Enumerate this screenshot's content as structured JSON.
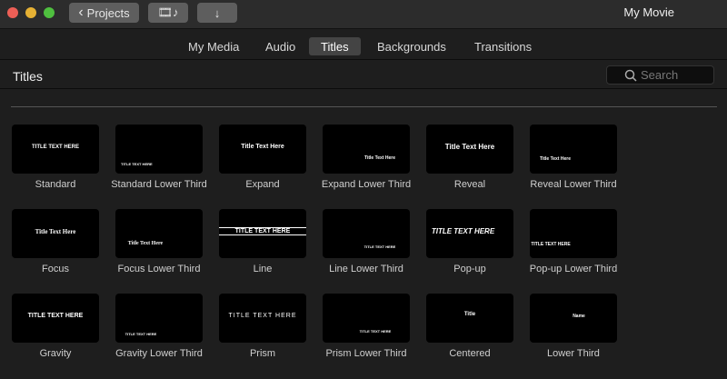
{
  "window": {
    "title": "My Movie",
    "back_label": "Projects"
  },
  "colors": {
    "close": "#ed5f56",
    "minimize": "#e6b134",
    "zoom": "#4fbf3f"
  },
  "tabs": [
    {
      "label": "My Media"
    },
    {
      "label": "Audio"
    },
    {
      "label": "Titles",
      "active": true
    },
    {
      "label": "Backgrounds"
    },
    {
      "label": "Transitions"
    }
  ],
  "header": {
    "title": "Titles",
    "search_placeholder": "Search"
  },
  "titles": [
    {
      "name": "Standard",
      "preview": "TITLE TEXT HERE"
    },
    {
      "name": "Standard Lower Third",
      "preview": "TITLE TEXT HERE"
    },
    {
      "name": "Expand",
      "preview": "Title Text Here"
    },
    {
      "name": "Expand Lower Third",
      "preview": "Title Text Here"
    },
    {
      "name": "Reveal",
      "preview": "Title Text Here"
    },
    {
      "name": "Reveal Lower Third",
      "preview": "Title Text Here"
    },
    {
      "name": "Focus",
      "preview": "Title Text Here"
    },
    {
      "name": "Focus Lower Third",
      "preview": "Title Text Here"
    },
    {
      "name": "Line",
      "preview": "TITLE TEXT HERE"
    },
    {
      "name": "Line Lower Third",
      "preview": "TITLE TEXT HERE"
    },
    {
      "name": "Pop-up",
      "preview": "TITLE TEXT HERE"
    },
    {
      "name": "Pop-up Lower Third",
      "preview": "TITLE TEXT HERE"
    },
    {
      "name": "Gravity",
      "preview": "TITLE TEXT HERE"
    },
    {
      "name": "Gravity Lower Third",
      "preview": "TITLE TEXT HERE"
    },
    {
      "name": "Prism",
      "preview": "TITLE TEXT HERE"
    },
    {
      "name": "Prism Lower Third",
      "preview": "TITLE TEXT HERE"
    },
    {
      "name": "Centered",
      "preview": "Title"
    },
    {
      "name": "Lower Third",
      "preview": "Name"
    }
  ]
}
